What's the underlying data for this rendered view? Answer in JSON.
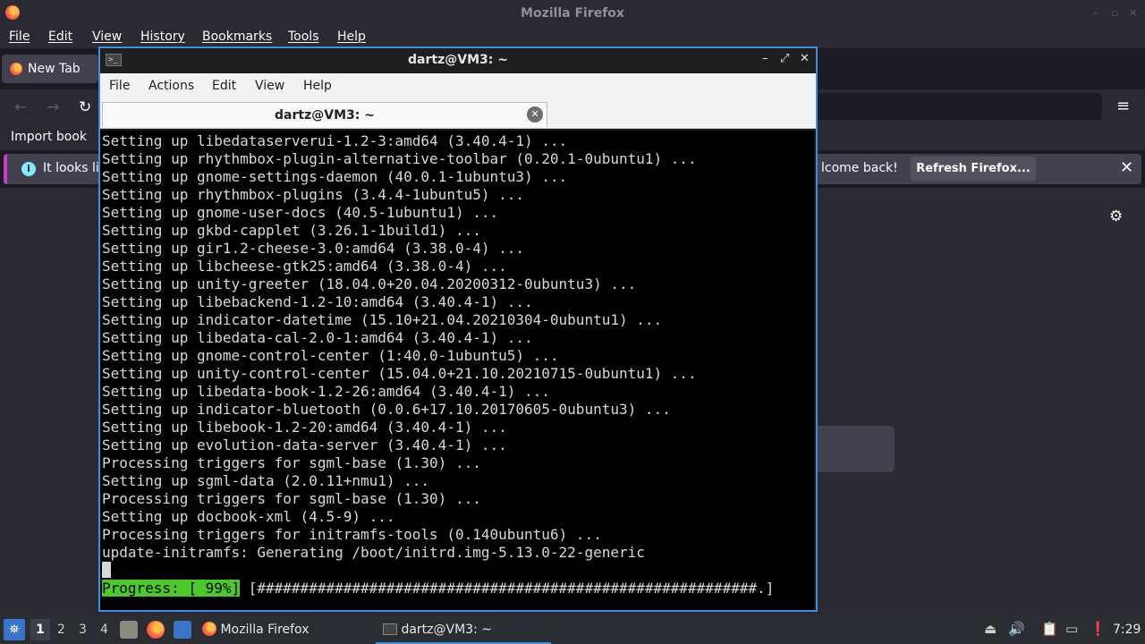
{
  "firefox": {
    "window_title": "Mozilla Firefox",
    "menu": [
      "File",
      "Edit",
      "View",
      "History",
      "Bookmarks",
      "Tools",
      "Help"
    ],
    "tab_label": "New Tab",
    "import_bookmarks": "Import book",
    "info_text_left": "It looks lik",
    "info_text_right": "lcome back!",
    "refresh_button": "Refresh Firefox..."
  },
  "terminal": {
    "window_title": "dartz@VM3: ~",
    "menu": [
      "File",
      "Actions",
      "Edit",
      "View",
      "Help"
    ],
    "tab_label": "dartz@VM3: ~",
    "lines": [
      "Setting up libedataserverui-1.2-3:amd64 (3.40.4-1) ...",
      "Setting up rhythmbox-plugin-alternative-toolbar (0.20.1-0ubuntu1) ...",
      "Setting up gnome-settings-daemon (40.0.1-1ubuntu3) ...",
      "Setting up rhythmbox-plugins (3.4.4-1ubuntu5) ...",
      "Setting up gnome-user-docs (40.5-1ubuntu1) ...",
      "Setting up gkbd-capplet (3.26.1-1build1) ...",
      "Setting up gir1.2-cheese-3.0:amd64 (3.38.0-4) ...",
      "Setting up libcheese-gtk25:amd64 (3.38.0-4) ...",
      "Setting up unity-greeter (18.04.0+20.04.20200312-0ubuntu3) ...",
      "Setting up libebackend-1.2-10:amd64 (3.40.4-1) ...",
      "Setting up indicator-datetime (15.10+21.04.20210304-0ubuntu1) ...",
      "Setting up libedata-cal-2.0-1:amd64 (3.40.4-1) ...",
      "Setting up gnome-control-center (1:40.0-1ubuntu5) ...",
      "Setting up unity-control-center (15.04.0+21.10.20210715-0ubuntu1) ...",
      "Setting up libedata-book-1.2-26:amd64 (3.40.4-1) ...",
      "Setting up indicator-bluetooth (0.0.6+17.10.20170605-0ubuntu3) ...",
      "Setting up libebook-1.2-20:amd64 (3.40.4-1) ...",
      "Setting up evolution-data-server (3.40.4-1) ...",
      "Processing triggers for sgml-base (1.30) ...",
      "Setting up sgml-data (2.0.11+nmu1) ...",
      "Processing triggers for sgml-base (1.30) ...",
      "Setting up docbook-xml (4.5-9) ...",
      "Processing triggers for initramfs-tools (0.140ubuntu6) ...",
      "update-initramfs: Generating /boot/initrd.img-5.13.0-22-generic"
    ],
    "progress_label": "Progress: [ 99%]",
    "progress_bar": " [##########################################################.]",
    "progress_percent": 99
  },
  "taskbar": {
    "workspaces": [
      "1",
      "2",
      "3",
      "4"
    ],
    "tasks": [
      "Mozilla Firefox",
      "dartz@VM3: ~"
    ],
    "clock": "7:29"
  }
}
